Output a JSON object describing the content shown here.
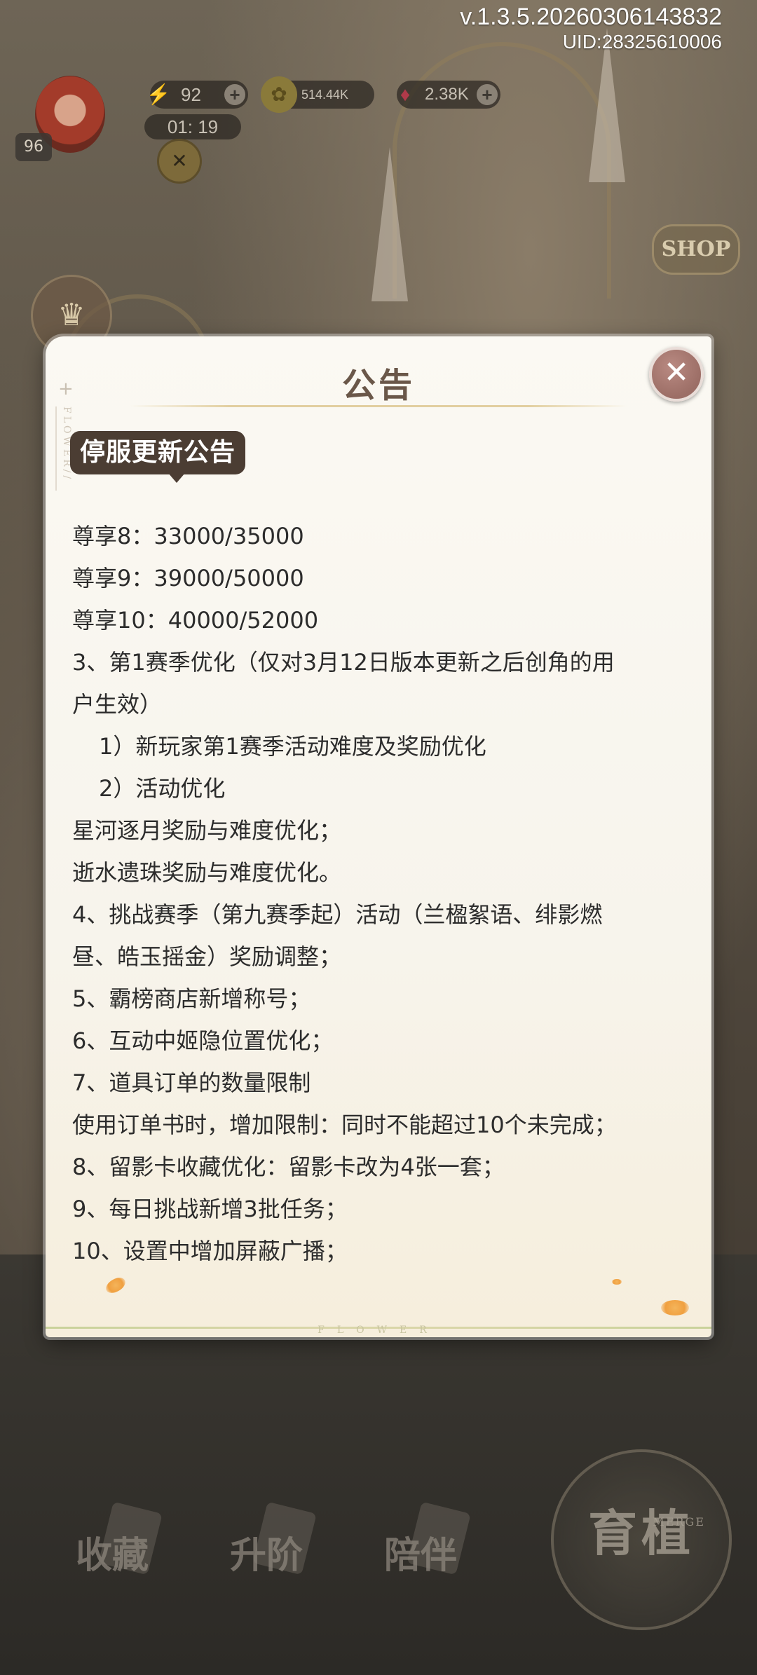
{
  "hud": {
    "version": "v.1.3.5.20260306143832",
    "uid": "UID:28325610006",
    "level": "96",
    "energy": "92",
    "timer": "01: 19",
    "coins": "514.44K",
    "gems": "2.38K",
    "shop_label": "SHOP"
  },
  "modal": {
    "title": "公告",
    "tag": "停服更新公告",
    "deco_text": "FLOWER//",
    "footer_text": "FLOWER",
    "lines": [
      "尊享8：33000/35000",
      "尊享9：39000/50000",
      "尊享10：40000/52000",
      "3、第1赛季优化（仅对3月12日版本更新之后创角的用",
      "户生效）",
      "1）新玩家第1赛季活动难度及奖励优化",
      "2）活动优化",
      "星河逐月奖励与难度优化；",
      "逝水遗珠奖励与难度优化。",
      "4、挑战赛季（第九赛季起）活动（兰楹絮语、绯影燃",
      "昼、皓玉摇金）奖励调整；",
      "5、霸榜商店新增称号；",
      "6、互动中姬隐位置优化；",
      "7、道具订单的数量限制",
      "使用订单书时，增加限制：同时不能超过10个未完成；",
      "8、留影卡收藏优化：留影卡改为4张一套；",
      "9、每日挑战新增3批任务；",
      "10、设置中增加屏蔽广播；"
    ]
  },
  "bottom_nav": {
    "collect": "收藏",
    "upgrade": "升阶",
    "companion": "陪伴",
    "grow": "育植",
    "merge": "MERGE"
  },
  "icons": {
    "close": "close-icon",
    "energy": "lightning-icon",
    "coin": "coin-icon",
    "gem": "gem-icon",
    "plus": "plus-icon"
  },
  "colors": {
    "modal_bg": "#fbf9f3",
    "title": "#6a5749",
    "tag_bg": "#4b3d33",
    "close_bg": "#9c6e66"
  }
}
